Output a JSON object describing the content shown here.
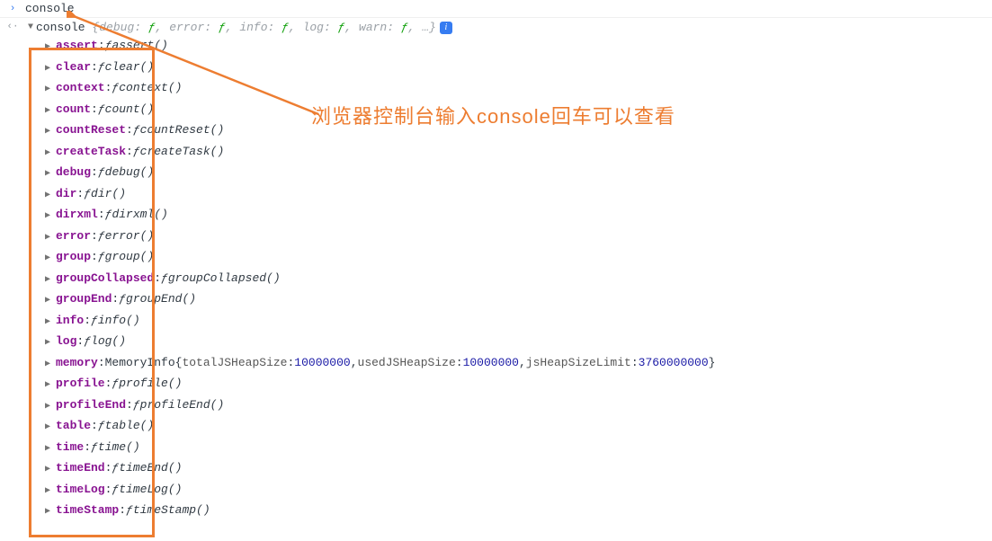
{
  "input": {
    "command": "console"
  },
  "output": {
    "header": {
      "name": "console",
      "preview": [
        {
          "key": "debug",
          "sym": "ƒ"
        },
        {
          "key": "error",
          "sym": "ƒ"
        },
        {
          "key": "info",
          "sym": "ƒ"
        },
        {
          "key": "log",
          "sym": "ƒ"
        },
        {
          "key": "warn",
          "sym": "ƒ"
        }
      ],
      "ellipsis": "…"
    },
    "info_badge": "i",
    "properties": [
      {
        "name": "assert",
        "kind": "fn",
        "call": "assert()"
      },
      {
        "name": "clear",
        "kind": "fn",
        "call": "clear()"
      },
      {
        "name": "context",
        "kind": "fn",
        "call": "context()"
      },
      {
        "name": "count",
        "kind": "fn",
        "call": "count()"
      },
      {
        "name": "countReset",
        "kind": "fn",
        "call": "countReset()"
      },
      {
        "name": "createTask",
        "kind": "fn",
        "call": "createTask()"
      },
      {
        "name": "debug",
        "kind": "fn",
        "call": "debug()"
      },
      {
        "name": "dir",
        "kind": "fn",
        "call": "dir()"
      },
      {
        "name": "dirxml",
        "kind": "fn",
        "call": "dirxml()"
      },
      {
        "name": "error",
        "kind": "fn",
        "call": "error()"
      },
      {
        "name": "group",
        "kind": "fn",
        "call": "group()"
      },
      {
        "name": "groupCollapsed",
        "kind": "fn",
        "call": "groupCollapsed()"
      },
      {
        "name": "groupEnd",
        "kind": "fn",
        "call": "groupEnd()"
      },
      {
        "name": "info",
        "kind": "fn",
        "call": "info()"
      },
      {
        "name": "log",
        "kind": "fn",
        "call": "log()"
      },
      {
        "name": "memory",
        "kind": "memory",
        "type": "MemoryInfo",
        "props": [
          {
            "k": "totalJSHeapSize",
            "v": "10000000"
          },
          {
            "k": "usedJSHeapSize",
            "v": "10000000"
          },
          {
            "k": "jsHeapSizeLimit",
            "v": "3760000000"
          }
        ]
      },
      {
        "name": "profile",
        "kind": "fn",
        "call": "profile()"
      },
      {
        "name": "profileEnd",
        "kind": "fn",
        "call": "profileEnd()"
      },
      {
        "name": "table",
        "kind": "fn",
        "call": "table()"
      },
      {
        "name": "time",
        "kind": "fn",
        "call": "time()"
      },
      {
        "name": "timeEnd",
        "kind": "fn",
        "call": "timeEnd()"
      },
      {
        "name": "timeLog",
        "kind": "fn",
        "call": "timeLog()"
      },
      {
        "name": "timeStamp",
        "kind": "fn",
        "call": "timeStamp()"
      }
    ]
  },
  "annotation": {
    "text": "浏览器控制台输入console回车可以查看"
  }
}
